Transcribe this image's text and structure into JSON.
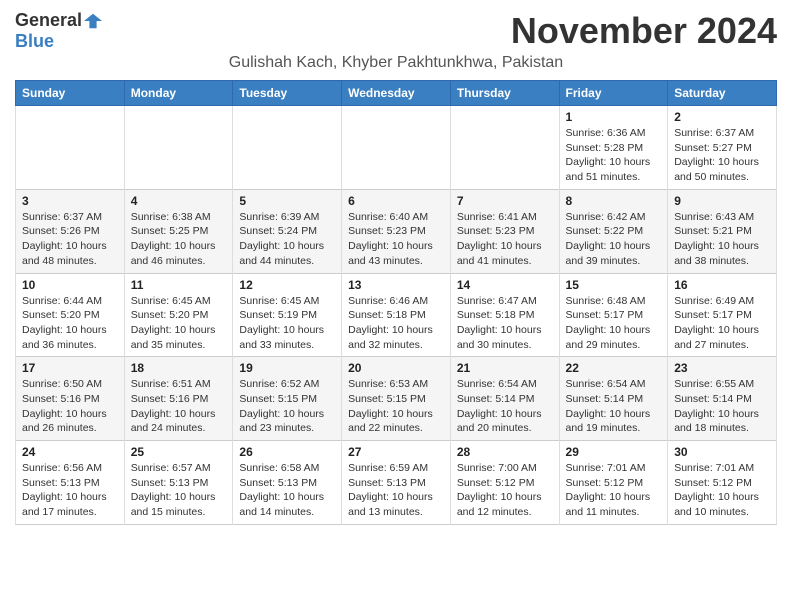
{
  "header": {
    "logo_general": "General",
    "logo_blue": "Blue",
    "month_title": "November 2024",
    "subtitle": "Gulishah Kach, Khyber Pakhtunkhwa, Pakistan"
  },
  "weekdays": [
    "Sunday",
    "Monday",
    "Tuesday",
    "Wednesday",
    "Thursday",
    "Friday",
    "Saturday"
  ],
  "weeks": [
    [
      {
        "day": "",
        "info": ""
      },
      {
        "day": "",
        "info": ""
      },
      {
        "day": "",
        "info": ""
      },
      {
        "day": "",
        "info": ""
      },
      {
        "day": "",
        "info": ""
      },
      {
        "day": "1",
        "info": "Sunrise: 6:36 AM\nSunset: 5:28 PM\nDaylight: 10 hours and 51 minutes."
      },
      {
        "day": "2",
        "info": "Sunrise: 6:37 AM\nSunset: 5:27 PM\nDaylight: 10 hours and 50 minutes."
      }
    ],
    [
      {
        "day": "3",
        "info": "Sunrise: 6:37 AM\nSunset: 5:26 PM\nDaylight: 10 hours and 48 minutes."
      },
      {
        "day": "4",
        "info": "Sunrise: 6:38 AM\nSunset: 5:25 PM\nDaylight: 10 hours and 46 minutes."
      },
      {
        "day": "5",
        "info": "Sunrise: 6:39 AM\nSunset: 5:24 PM\nDaylight: 10 hours and 44 minutes."
      },
      {
        "day": "6",
        "info": "Sunrise: 6:40 AM\nSunset: 5:23 PM\nDaylight: 10 hours and 43 minutes."
      },
      {
        "day": "7",
        "info": "Sunrise: 6:41 AM\nSunset: 5:23 PM\nDaylight: 10 hours and 41 minutes."
      },
      {
        "day": "8",
        "info": "Sunrise: 6:42 AM\nSunset: 5:22 PM\nDaylight: 10 hours and 39 minutes."
      },
      {
        "day": "9",
        "info": "Sunrise: 6:43 AM\nSunset: 5:21 PM\nDaylight: 10 hours and 38 minutes."
      }
    ],
    [
      {
        "day": "10",
        "info": "Sunrise: 6:44 AM\nSunset: 5:20 PM\nDaylight: 10 hours and 36 minutes."
      },
      {
        "day": "11",
        "info": "Sunrise: 6:45 AM\nSunset: 5:20 PM\nDaylight: 10 hours and 35 minutes."
      },
      {
        "day": "12",
        "info": "Sunrise: 6:45 AM\nSunset: 5:19 PM\nDaylight: 10 hours and 33 minutes."
      },
      {
        "day": "13",
        "info": "Sunrise: 6:46 AM\nSunset: 5:18 PM\nDaylight: 10 hours and 32 minutes."
      },
      {
        "day": "14",
        "info": "Sunrise: 6:47 AM\nSunset: 5:18 PM\nDaylight: 10 hours and 30 minutes."
      },
      {
        "day": "15",
        "info": "Sunrise: 6:48 AM\nSunset: 5:17 PM\nDaylight: 10 hours and 29 minutes."
      },
      {
        "day": "16",
        "info": "Sunrise: 6:49 AM\nSunset: 5:17 PM\nDaylight: 10 hours and 27 minutes."
      }
    ],
    [
      {
        "day": "17",
        "info": "Sunrise: 6:50 AM\nSunset: 5:16 PM\nDaylight: 10 hours and 26 minutes."
      },
      {
        "day": "18",
        "info": "Sunrise: 6:51 AM\nSunset: 5:16 PM\nDaylight: 10 hours and 24 minutes."
      },
      {
        "day": "19",
        "info": "Sunrise: 6:52 AM\nSunset: 5:15 PM\nDaylight: 10 hours and 23 minutes."
      },
      {
        "day": "20",
        "info": "Sunrise: 6:53 AM\nSunset: 5:15 PM\nDaylight: 10 hours and 22 minutes."
      },
      {
        "day": "21",
        "info": "Sunrise: 6:54 AM\nSunset: 5:14 PM\nDaylight: 10 hours and 20 minutes."
      },
      {
        "day": "22",
        "info": "Sunrise: 6:54 AM\nSunset: 5:14 PM\nDaylight: 10 hours and 19 minutes."
      },
      {
        "day": "23",
        "info": "Sunrise: 6:55 AM\nSunset: 5:14 PM\nDaylight: 10 hours and 18 minutes."
      }
    ],
    [
      {
        "day": "24",
        "info": "Sunrise: 6:56 AM\nSunset: 5:13 PM\nDaylight: 10 hours and 17 minutes."
      },
      {
        "day": "25",
        "info": "Sunrise: 6:57 AM\nSunset: 5:13 PM\nDaylight: 10 hours and 15 minutes."
      },
      {
        "day": "26",
        "info": "Sunrise: 6:58 AM\nSunset: 5:13 PM\nDaylight: 10 hours and 14 minutes."
      },
      {
        "day": "27",
        "info": "Sunrise: 6:59 AM\nSunset: 5:13 PM\nDaylight: 10 hours and 13 minutes."
      },
      {
        "day": "28",
        "info": "Sunrise: 7:00 AM\nSunset: 5:12 PM\nDaylight: 10 hours and 12 minutes."
      },
      {
        "day": "29",
        "info": "Sunrise: 7:01 AM\nSunset: 5:12 PM\nDaylight: 10 hours and 11 minutes."
      },
      {
        "day": "30",
        "info": "Sunrise: 7:01 AM\nSunset: 5:12 PM\nDaylight: 10 hours and 10 minutes."
      }
    ]
  ]
}
